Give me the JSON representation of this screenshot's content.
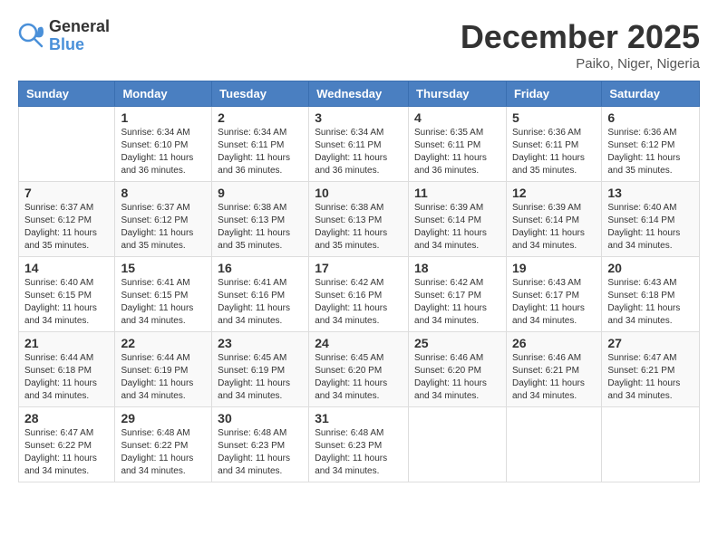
{
  "header": {
    "logo": {
      "general": "General",
      "blue": "Blue"
    },
    "title": "December 2025",
    "location": "Paiko, Niger, Nigeria"
  },
  "calendar": {
    "days_of_week": [
      "Sunday",
      "Monday",
      "Tuesday",
      "Wednesday",
      "Thursday",
      "Friday",
      "Saturday"
    ],
    "weeks": [
      [
        {
          "day": "",
          "info": ""
        },
        {
          "day": "1",
          "info": "Sunrise: 6:34 AM\nSunset: 6:10 PM\nDaylight: 11 hours and 36 minutes."
        },
        {
          "day": "2",
          "info": "Sunrise: 6:34 AM\nSunset: 6:11 PM\nDaylight: 11 hours and 36 minutes."
        },
        {
          "day": "3",
          "info": "Sunrise: 6:34 AM\nSunset: 6:11 PM\nDaylight: 11 hours and 36 minutes."
        },
        {
          "day": "4",
          "info": "Sunrise: 6:35 AM\nSunset: 6:11 PM\nDaylight: 11 hours and 36 minutes."
        },
        {
          "day": "5",
          "info": "Sunrise: 6:36 AM\nSunset: 6:11 PM\nDaylight: 11 hours and 35 minutes."
        },
        {
          "day": "6",
          "info": "Sunrise: 6:36 AM\nSunset: 6:12 PM\nDaylight: 11 hours and 35 minutes."
        }
      ],
      [
        {
          "day": "7",
          "info": "Sunrise: 6:37 AM\nSunset: 6:12 PM\nDaylight: 11 hours and 35 minutes."
        },
        {
          "day": "8",
          "info": "Sunrise: 6:37 AM\nSunset: 6:12 PM\nDaylight: 11 hours and 35 minutes."
        },
        {
          "day": "9",
          "info": "Sunrise: 6:38 AM\nSunset: 6:13 PM\nDaylight: 11 hours and 35 minutes."
        },
        {
          "day": "10",
          "info": "Sunrise: 6:38 AM\nSunset: 6:13 PM\nDaylight: 11 hours and 35 minutes."
        },
        {
          "day": "11",
          "info": "Sunrise: 6:39 AM\nSunset: 6:14 PM\nDaylight: 11 hours and 34 minutes."
        },
        {
          "day": "12",
          "info": "Sunrise: 6:39 AM\nSunset: 6:14 PM\nDaylight: 11 hours and 34 minutes."
        },
        {
          "day": "13",
          "info": "Sunrise: 6:40 AM\nSunset: 6:14 PM\nDaylight: 11 hours and 34 minutes."
        }
      ],
      [
        {
          "day": "14",
          "info": "Sunrise: 6:40 AM\nSunset: 6:15 PM\nDaylight: 11 hours and 34 minutes."
        },
        {
          "day": "15",
          "info": "Sunrise: 6:41 AM\nSunset: 6:15 PM\nDaylight: 11 hours and 34 minutes."
        },
        {
          "day": "16",
          "info": "Sunrise: 6:41 AM\nSunset: 6:16 PM\nDaylight: 11 hours and 34 minutes."
        },
        {
          "day": "17",
          "info": "Sunrise: 6:42 AM\nSunset: 6:16 PM\nDaylight: 11 hours and 34 minutes."
        },
        {
          "day": "18",
          "info": "Sunrise: 6:42 AM\nSunset: 6:17 PM\nDaylight: 11 hours and 34 minutes."
        },
        {
          "day": "19",
          "info": "Sunrise: 6:43 AM\nSunset: 6:17 PM\nDaylight: 11 hours and 34 minutes."
        },
        {
          "day": "20",
          "info": "Sunrise: 6:43 AM\nSunset: 6:18 PM\nDaylight: 11 hours and 34 minutes."
        }
      ],
      [
        {
          "day": "21",
          "info": "Sunrise: 6:44 AM\nSunset: 6:18 PM\nDaylight: 11 hours and 34 minutes."
        },
        {
          "day": "22",
          "info": "Sunrise: 6:44 AM\nSunset: 6:19 PM\nDaylight: 11 hours and 34 minutes."
        },
        {
          "day": "23",
          "info": "Sunrise: 6:45 AM\nSunset: 6:19 PM\nDaylight: 11 hours and 34 minutes."
        },
        {
          "day": "24",
          "info": "Sunrise: 6:45 AM\nSunset: 6:20 PM\nDaylight: 11 hours and 34 minutes."
        },
        {
          "day": "25",
          "info": "Sunrise: 6:46 AM\nSunset: 6:20 PM\nDaylight: 11 hours and 34 minutes."
        },
        {
          "day": "26",
          "info": "Sunrise: 6:46 AM\nSunset: 6:21 PM\nDaylight: 11 hours and 34 minutes."
        },
        {
          "day": "27",
          "info": "Sunrise: 6:47 AM\nSunset: 6:21 PM\nDaylight: 11 hours and 34 minutes."
        }
      ],
      [
        {
          "day": "28",
          "info": "Sunrise: 6:47 AM\nSunset: 6:22 PM\nDaylight: 11 hours and 34 minutes."
        },
        {
          "day": "29",
          "info": "Sunrise: 6:48 AM\nSunset: 6:22 PM\nDaylight: 11 hours and 34 minutes."
        },
        {
          "day": "30",
          "info": "Sunrise: 6:48 AM\nSunset: 6:23 PM\nDaylight: 11 hours and 34 minutes."
        },
        {
          "day": "31",
          "info": "Sunrise: 6:48 AM\nSunset: 6:23 PM\nDaylight: 11 hours and 34 minutes."
        },
        {
          "day": "",
          "info": ""
        },
        {
          "day": "",
          "info": ""
        },
        {
          "day": "",
          "info": ""
        }
      ]
    ]
  }
}
